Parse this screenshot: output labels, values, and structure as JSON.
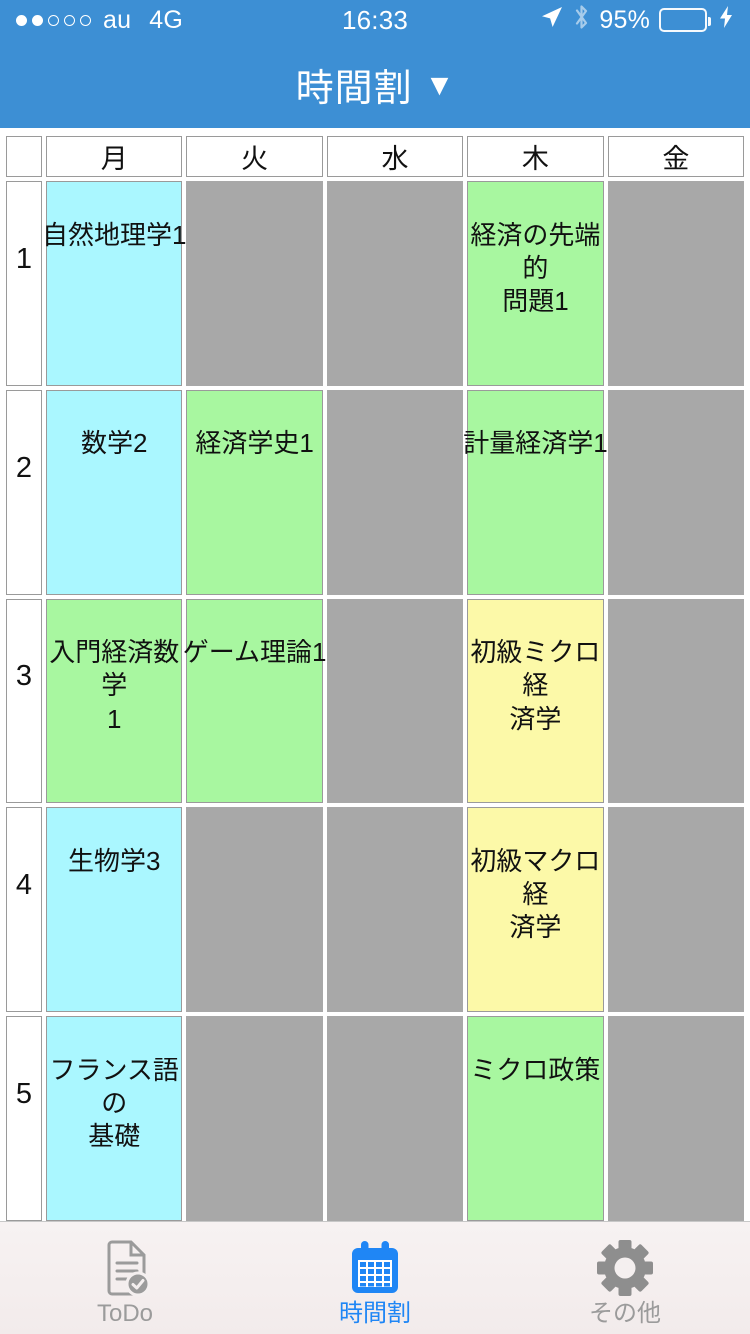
{
  "status_bar": {
    "signal_bars_filled": 2,
    "signal_bars_total": 5,
    "carrier": "au",
    "network": "4G",
    "time": "16:33",
    "battery_percent": "95%",
    "battery_level": 95,
    "location_icon": "location-arrow-icon",
    "bluetooth_icon": "bluetooth-icon",
    "charging_icon": "lightning-bolt-icon"
  },
  "navbar": {
    "title": "時間割",
    "caret": "▼",
    "background_color": "#3d8fd4"
  },
  "timetable": {
    "corner_label": "",
    "days": [
      "月",
      "火",
      "水",
      "木",
      "金"
    ],
    "periods": [
      "1",
      "2",
      "3",
      "4",
      "5"
    ],
    "colors": {
      "cyan": "#aaf7ff",
      "green": "#a8f7a0",
      "yellow": "#fcf9a8",
      "empty": "#a8a8a8",
      "border": "#9a9a9a"
    },
    "rows": [
      {
        "period": "1",
        "slots": [
          {
            "label": "自然地理学1",
            "color": "cyan"
          },
          {
            "label": "",
            "color": "empty"
          },
          {
            "label": "",
            "color": "empty"
          },
          {
            "label": "経済の先端的\n問題1",
            "color": "green"
          },
          {
            "label": "",
            "color": "empty"
          }
        ]
      },
      {
        "period": "2",
        "slots": [
          {
            "label": "数学2",
            "color": "cyan"
          },
          {
            "label": "経済学史1",
            "color": "green"
          },
          {
            "label": "",
            "color": "empty"
          },
          {
            "label": "計量経済学1",
            "color": "green"
          },
          {
            "label": "",
            "color": "empty"
          }
        ]
      },
      {
        "period": "3",
        "slots": [
          {
            "label": "入門経済数学\n1",
            "color": "green"
          },
          {
            "label": "ゲーム理論1",
            "color": "green"
          },
          {
            "label": "",
            "color": "empty"
          },
          {
            "label": "初級ミクロ経\n済学",
            "color": "yellow"
          },
          {
            "label": "",
            "color": "empty"
          }
        ]
      },
      {
        "period": "4",
        "slots": [
          {
            "label": "生物学3",
            "color": "cyan"
          },
          {
            "label": "",
            "color": "empty"
          },
          {
            "label": "",
            "color": "empty"
          },
          {
            "label": "初級マクロ経\n済学",
            "color": "yellow"
          },
          {
            "label": "",
            "color": "empty"
          }
        ]
      },
      {
        "period": "5",
        "slots": [
          {
            "label": "フランス語の\n基礎",
            "color": "cyan"
          },
          {
            "label": "",
            "color": "empty"
          },
          {
            "label": "",
            "color": "empty"
          },
          {
            "label": "ミクロ政策",
            "color": "green"
          },
          {
            "label": "",
            "color": "empty"
          }
        ]
      }
    ]
  },
  "tabbar": {
    "active_color": "#1f86f5",
    "inactive_color": "#9b9b9b",
    "tabs": [
      {
        "label": "ToDo",
        "icon": "document-check-icon",
        "active": false
      },
      {
        "label": "時間割",
        "icon": "calendar-icon",
        "active": true
      },
      {
        "label": "その他",
        "icon": "gear-icon",
        "active": false
      }
    ]
  }
}
